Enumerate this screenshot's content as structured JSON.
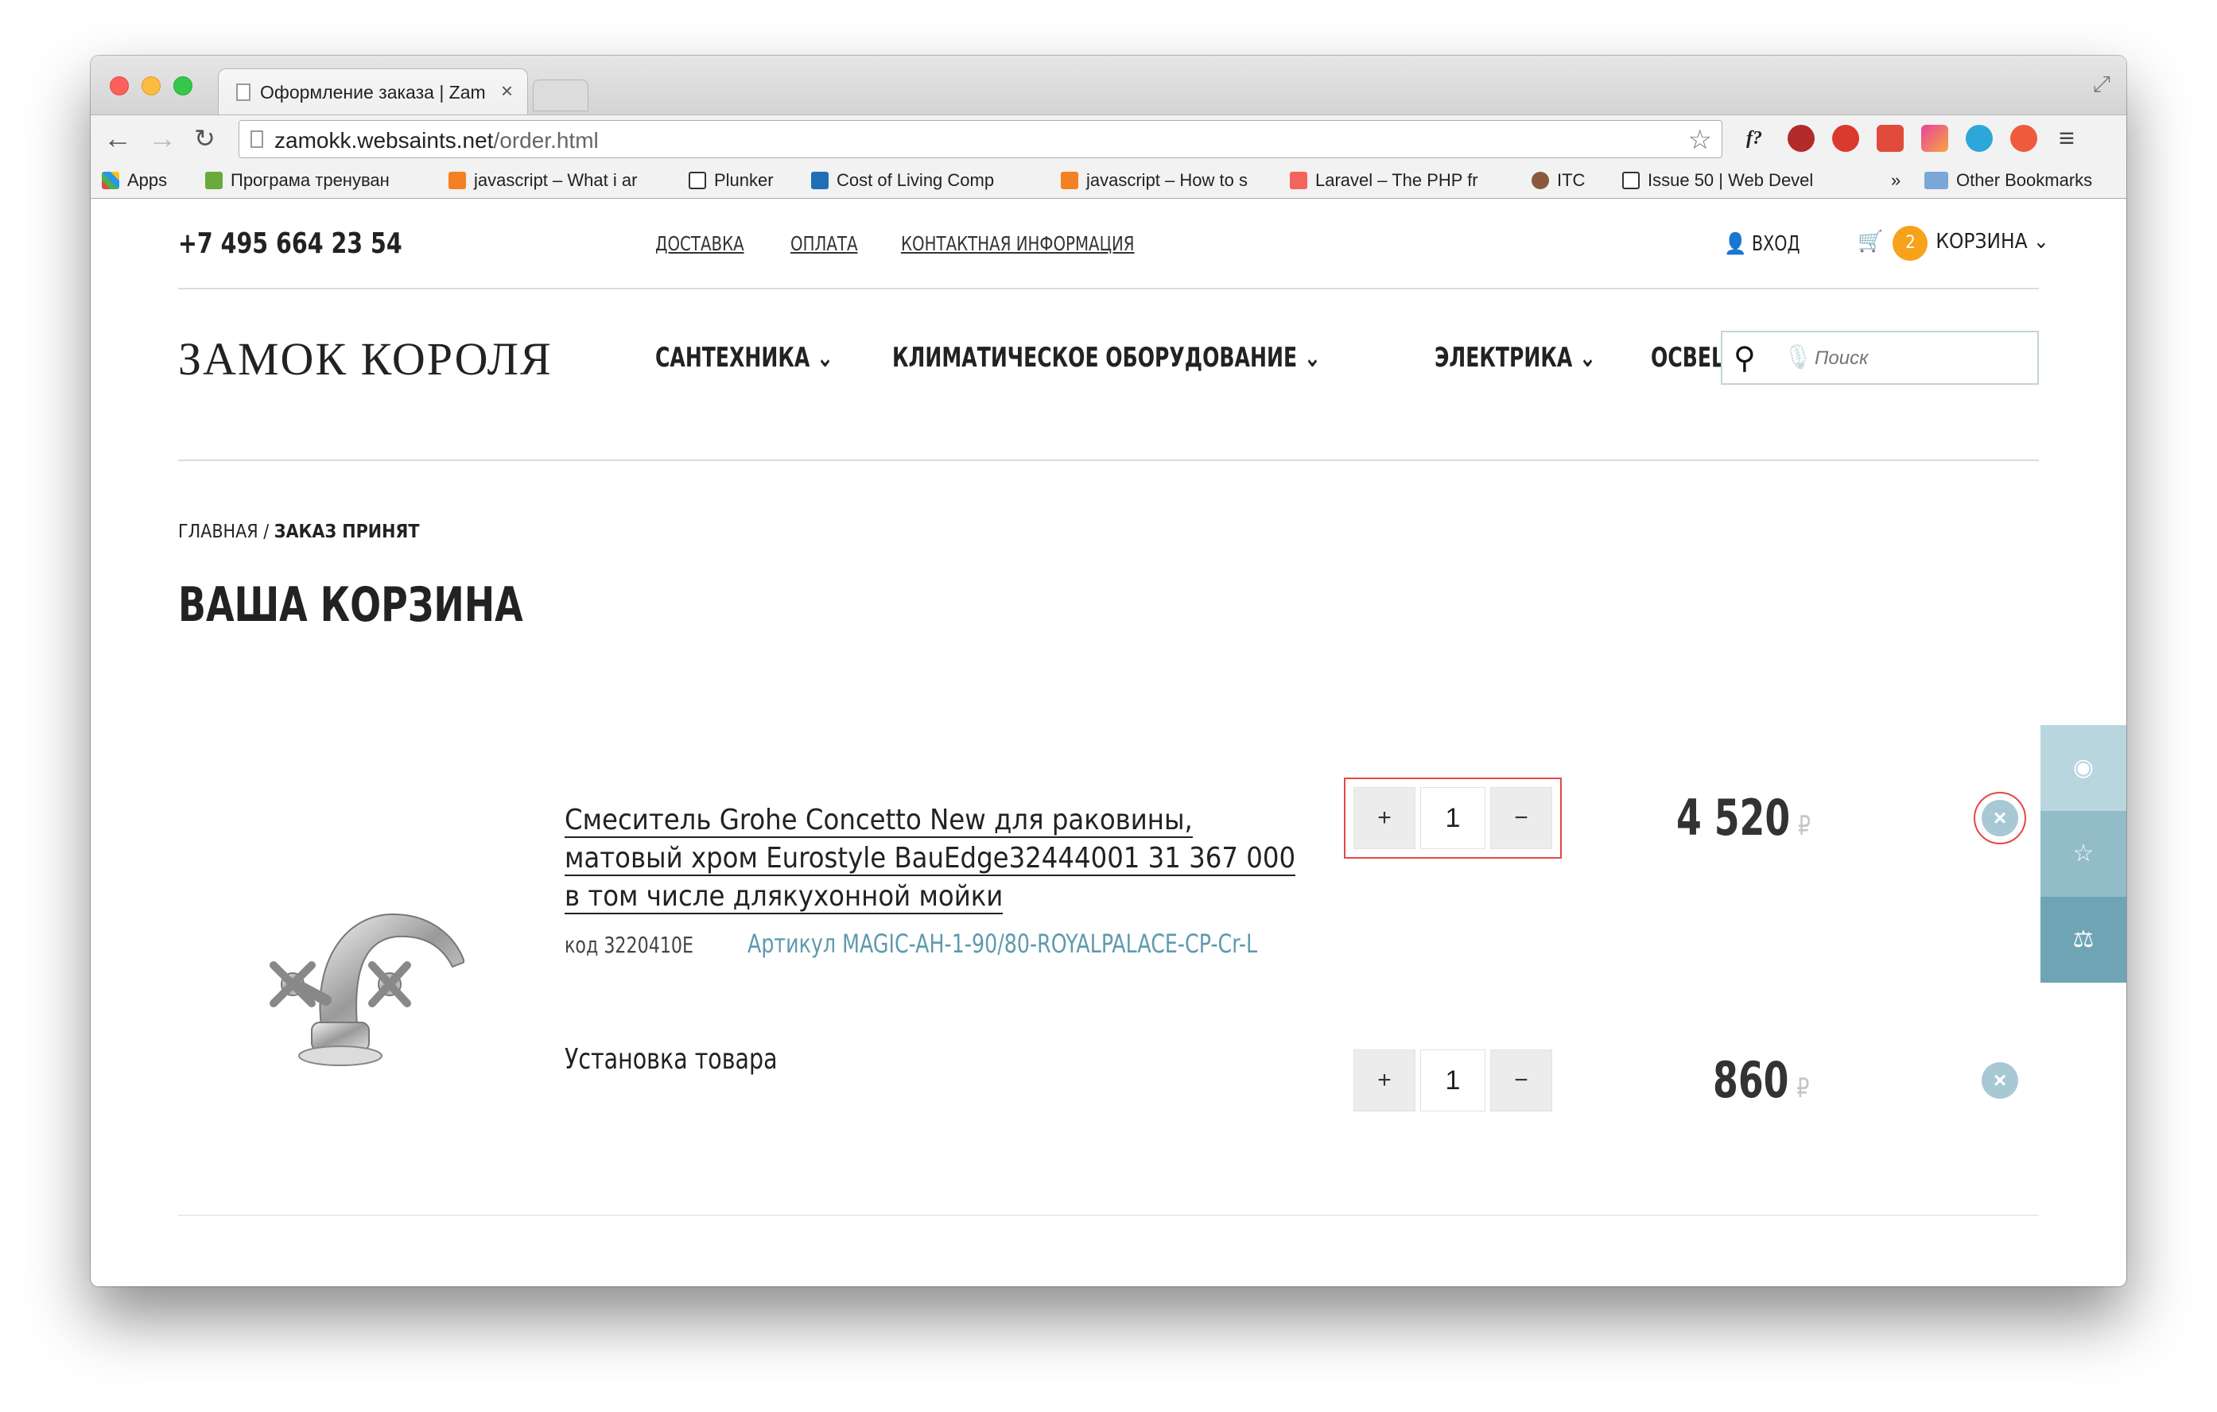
{
  "browser": {
    "tab_title": "Оформление заказа | Zam",
    "tab_close": "×",
    "url_host": "zamokk.websaints.net",
    "url_path": "/order.html",
    "bookmarks": [
      "Apps",
      "Програма тренуван",
      "javascript – What i ar",
      "Plunker",
      "Cost of Living Comp",
      "javascript – How to s",
      "Laravel – The PHP fr",
      "ITC",
      "Issue 50 | Web Devel",
      "»",
      "Other Bookmarks"
    ],
    "extension_f": "f?"
  },
  "header": {
    "phone": "+7 495 664 23 54",
    "links": [
      "ДОСТАВКА",
      "ОПЛАТА",
      "КОНТАКТНАЯ ИНФОРМАЦИЯ"
    ],
    "login": "ВХОД",
    "cart_count": "2",
    "cart_label": "КОРЗИНА"
  },
  "logo": "ЗАМОК КОРОЛЯ",
  "nav": [
    "САНТЕХНИКА",
    "КЛИМАТИЧЕСКОЕ ОБОРУДОВАНИЕ",
    "ЭЛЕКТРИКА",
    "ОСВЕЩЕНИЕ"
  ],
  "search": {
    "placeholder": "Поиск"
  },
  "breadcrumb": {
    "home": "ГЛАВНАЯ",
    "separator": " / ",
    "current": "ЗАКАЗ ПРИНЯТ"
  },
  "page_title": "ВАША КОРЗИНА",
  "cart": {
    "items": [
      {
        "title": "Смеситель Grohe Concetto New для раковины, матовый хром Eurostyle BauEdge32444001 31 367 000 в том числе длякухонной мойки",
        "code": "код 3220410E",
        "article": "Артикул MAGIC-AH-1-90/80-ROYALPALACE-CP-Cr-L",
        "quantity": "1",
        "price": "4 520",
        "currency": "₽"
      },
      {
        "title": "Установка товара",
        "quantity": "1",
        "price": "860",
        "currency": "₽"
      }
    ],
    "plus": "+",
    "minus": "−"
  },
  "colors": {
    "accent_badge": "#f7a21b",
    "link_article": "#5e9aad",
    "highlight_red": "#e64646",
    "side_panel": [
      "#b9d6de",
      "#92bcc8",
      "#6ea4b4"
    ]
  }
}
